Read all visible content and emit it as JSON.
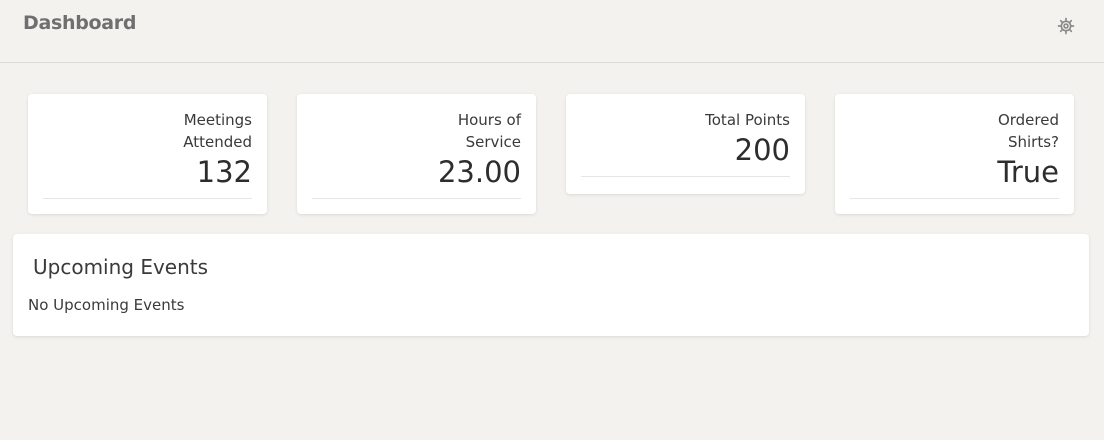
{
  "header": {
    "title": "Dashboard",
    "settings_icon": "gear-icon"
  },
  "stats": [
    {
      "label": "Meetings Attended",
      "value": "132"
    },
    {
      "label": "Hours of Service",
      "value": "23.00"
    },
    {
      "label": "Total Points",
      "value": "200"
    },
    {
      "label": "Ordered Shirts?",
      "value": "True"
    }
  ],
  "events": {
    "title": "Upcoming Events",
    "empty_message": "No Upcoming Events"
  },
  "colors": {
    "background": "#f3f2ee",
    "card": "#ffffff",
    "title": "#6f6f6f",
    "text": "#3a3a3a"
  }
}
